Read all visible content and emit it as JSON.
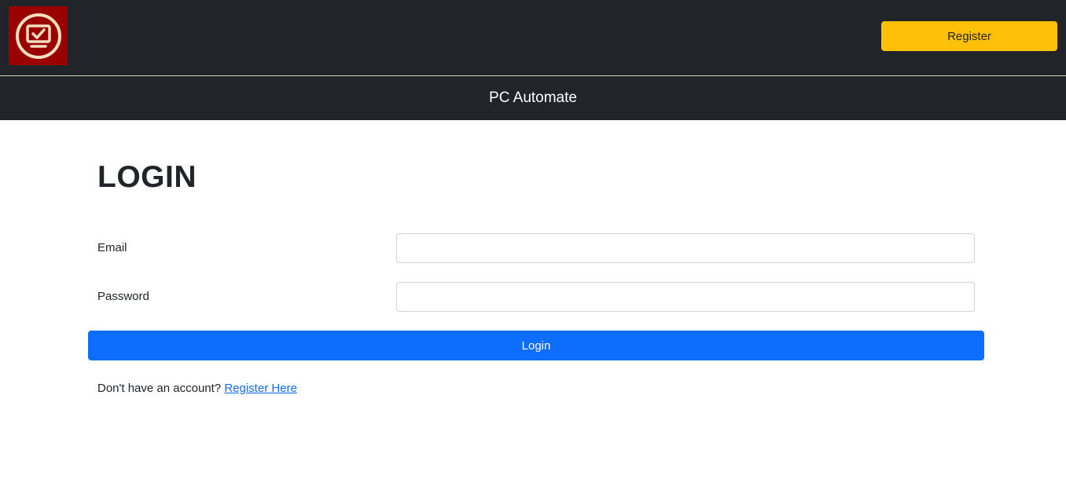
{
  "header": {
    "logo_icon": "monitor-check-icon",
    "register_label": "Register",
    "brand_title": "PC Automate"
  },
  "login": {
    "heading": "LOGIN",
    "email_label": "Email",
    "email_value": "",
    "password_label": "Password",
    "password_value": "",
    "submit_label": "Login",
    "signup_prompt": "Don't have an account?",
    "signup_link": "Register Here"
  },
  "colors": {
    "navbar_bg": "#212529",
    "logo_bg": "#9b0000",
    "register_button": "#ffc107",
    "login_button": "#0d6efd",
    "link": "#0d6efd"
  }
}
